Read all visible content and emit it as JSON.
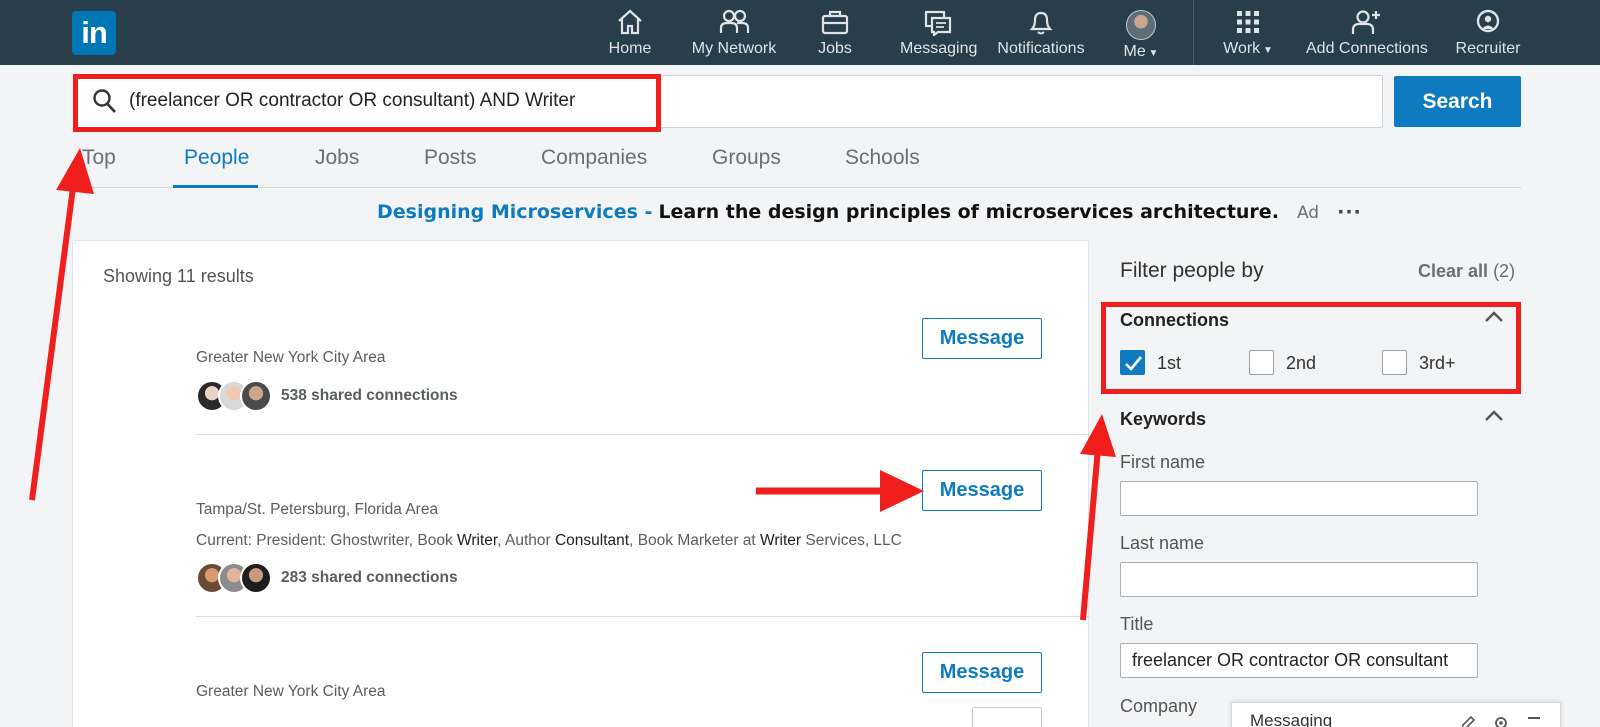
{
  "nav": {
    "items": [
      {
        "label": "Home",
        "icon": "home-icon"
      },
      {
        "label": "My Network",
        "icon": "my-network-icon"
      },
      {
        "label": "Jobs",
        "icon": "briefcase-icon"
      },
      {
        "label": "Messaging",
        "icon": "messaging-icon"
      },
      {
        "label": "Notifications",
        "icon": "bell-icon"
      },
      {
        "label": "Me",
        "icon": "avatar"
      },
      {
        "label": "Work",
        "icon": "grid-icon"
      },
      {
        "label": "Add Connections",
        "icon": "add-person-icon"
      },
      {
        "label": "Recruiter",
        "icon": "recruiter-icon"
      }
    ],
    "logo": "in"
  },
  "search": {
    "query": "(freelancer OR contractor OR consultant) AND Writer",
    "button_label": "Search"
  },
  "tabs": [
    "Top",
    "People",
    "Jobs",
    "Posts",
    "Companies",
    "Groups",
    "Schools"
  ],
  "active_tab": "People",
  "ad": {
    "link": "Designing Microservices -",
    "text": "Learn the design principles of microservices architecture.",
    "tag": "Ad",
    "more": "···"
  },
  "results": {
    "showing": "Showing 11 results",
    "items": [
      {
        "location": "Greater New York City Area",
        "current": "",
        "shared": "538 shared connections",
        "button": "Message"
      },
      {
        "location": "Tampa/St. Petersburg, Florida Area",
        "current_parts": [
          "Current: President: Ghostwriter, Book ",
          "Writer",
          ", Author ",
          "Consultant",
          ", Book Marketer at ",
          "Writer",
          " Services, LLC"
        ],
        "shared": "283 shared connections",
        "button": "Message"
      },
      {
        "location": "Greater New York City Area",
        "current": "",
        "shared": "",
        "button": "Message"
      }
    ]
  },
  "filters": {
    "title": "Filter people by",
    "clear_all": "Clear all",
    "clear_count": "(2)",
    "connections": {
      "title": "Connections",
      "options": [
        {
          "label": "1st",
          "checked": true
        },
        {
          "label": "2nd",
          "checked": false
        },
        {
          "label": "3rd+",
          "checked": false
        }
      ]
    },
    "keywords": {
      "title": "Keywords",
      "first_name": {
        "label": "First name",
        "value": ""
      },
      "last_name": {
        "label": "Last name",
        "value": ""
      },
      "title_field": {
        "label": "Title",
        "value": "freelancer OR contractor OR consultant"
      },
      "company": {
        "label": "Company"
      }
    }
  },
  "messaging_widget": {
    "title": "Messaging"
  },
  "colors": {
    "brand": "#0e7bc0",
    "nav_bg": "#283e4a",
    "annotation": "#f11e1e"
  }
}
